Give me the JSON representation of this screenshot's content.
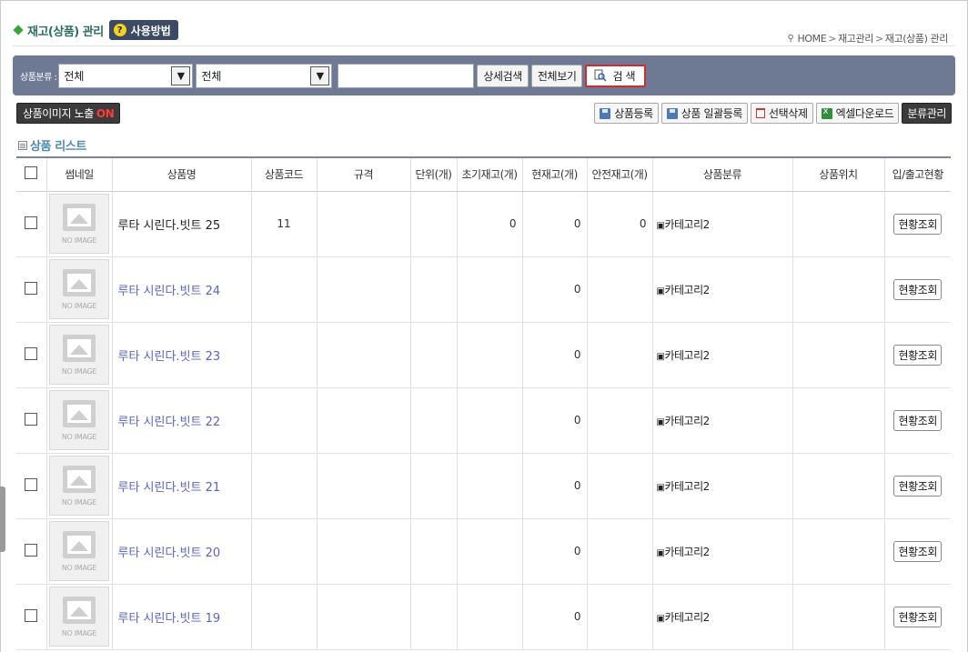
{
  "header": {
    "title": "재고(상품) 관리",
    "help_label": "사용방법",
    "help_icon": "?",
    "breadcrumb": [
      "HOME",
      "재고관리",
      "재고(상품) 관리"
    ]
  },
  "search": {
    "category_label": "상품분류 :",
    "select1": "전체",
    "select2": "전체",
    "keyword_value": "",
    "detail_label": "상세검색",
    "viewall_label": "전체보기",
    "search_label": "검 색"
  },
  "toolbar": {
    "image_toggle_label": "상품이미지 노출",
    "image_toggle_state": "ON",
    "register_label": "상품등록",
    "bulk_register_label": "상품 일괄등록",
    "delete_label": "선택삭제",
    "excel_label": "엑셀다운로드",
    "category_manage_label": "분류관리"
  },
  "list": {
    "title": "상품 리스트",
    "columns": [
      "썸네일",
      "상품명",
      "상품코드",
      "규격",
      "단위(개)",
      "초기재고(개)",
      "현재고(개)",
      "안전재고(개)",
      "상품분류",
      "상품위치",
      "입/출고현황"
    ],
    "no_image_text": "NO IMAGE",
    "status_button_label": "현황조회",
    "rows": [
      {
        "name": "루타 시린다.빗트 25",
        "code": "11",
        "spec": "",
        "unit": "",
        "initial": "0",
        "current": "0",
        "safety": "0",
        "category": "카테고리2",
        "location": "",
        "is_link": false
      },
      {
        "name": "루타 시린다.빗트 24",
        "code": "",
        "spec": "",
        "unit": "",
        "initial": "",
        "current": "0",
        "safety": "",
        "category": "카테고리2",
        "location": "",
        "is_link": true
      },
      {
        "name": "루타 시린다.빗트 23",
        "code": "",
        "spec": "",
        "unit": "",
        "initial": "",
        "current": "0",
        "safety": "",
        "category": "카테고리2",
        "location": "",
        "is_link": true
      },
      {
        "name": "루타 시린다.빗트 22",
        "code": "",
        "spec": "",
        "unit": "",
        "initial": "",
        "current": "0",
        "safety": "",
        "category": "카테고리2",
        "location": "",
        "is_link": true
      },
      {
        "name": "루타 시린다.빗트 21",
        "code": "",
        "spec": "",
        "unit": "",
        "initial": "",
        "current": "0",
        "safety": "",
        "category": "카테고리2",
        "location": "",
        "is_link": true
      },
      {
        "name": "루타 시린다.빗트 20",
        "code": "",
        "spec": "",
        "unit": "",
        "initial": "",
        "current": "0",
        "safety": "",
        "category": "카테고리2",
        "location": "",
        "is_link": true
      },
      {
        "name": "루타 시린다.빗트 19",
        "code": "",
        "spec": "",
        "unit": "",
        "initial": "",
        "current": "0",
        "safety": "",
        "category": "카테고리2",
        "location": "",
        "is_link": true
      }
    ]
  },
  "colors": {
    "accent": "#6e7a94",
    "title": "#2c6f62",
    "link": "#5a64c8",
    "search_border": "#d12b2b"
  }
}
